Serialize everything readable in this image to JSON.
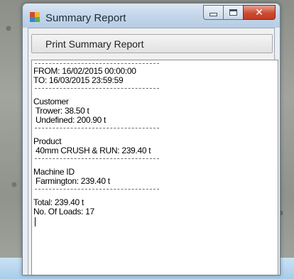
{
  "window": {
    "title": "Summary Report",
    "buttons": {
      "minimize": "minimize",
      "maximize": "maximize",
      "close": "close"
    }
  },
  "toolbar": {
    "print_label": "Print Summary Report"
  },
  "report": {
    "separator": "----------------------------------------------------",
    "date_range": {
      "from": "FROM: 16/02/2015 00:00:00",
      "to": "TO: 16/03/2015 23:59:59"
    },
    "customer": {
      "header": "Customer",
      "items": [
        " Trower: 38.50 t",
        " Undefined: 200.90 t"
      ]
    },
    "product": {
      "header": "Product",
      "items": [
        " 40mm CRUSH & RUN: 239.40 t"
      ]
    },
    "machine": {
      "header": "Machine ID",
      "items": [
        " Farmington: 239.40 t"
      ]
    },
    "totals": {
      "total": "Total: 239.40 t",
      "loads": "No. Of Loads: 17"
    }
  },
  "colors": {
    "close_button": "#cc4b32",
    "titlebar": "#c3d6ea",
    "taskbar": "#a8cde9"
  }
}
